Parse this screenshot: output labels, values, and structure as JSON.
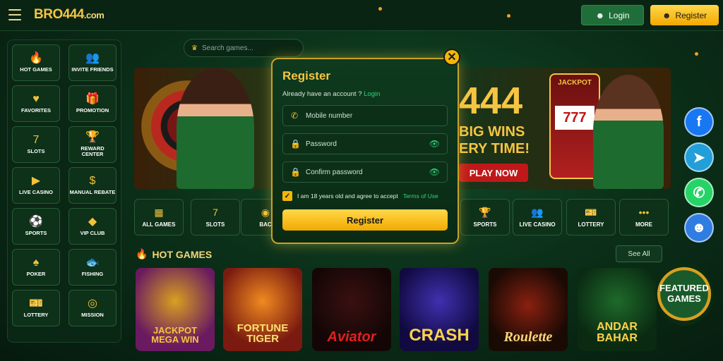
{
  "header": {
    "logo": "BRO444",
    "logo_suffix": ".com",
    "login_label": "Login",
    "register_label": "Register"
  },
  "search": {
    "placeholder": "Search games..."
  },
  "sidebar": {
    "items": [
      {
        "label": "HOT GAMES",
        "icon": "flame-icon"
      },
      {
        "label": "INVITE FRIENDS",
        "icon": "friends-icon"
      },
      {
        "label": "FAVORITES",
        "icon": "heart-icon"
      },
      {
        "label": "PROMOTION",
        "icon": "gift-icon"
      },
      {
        "label": "SLOTS",
        "icon": "slot-icon"
      },
      {
        "label": "REWARD CENTER",
        "icon": "trophy-icon"
      },
      {
        "label": "LIVE CASINO",
        "icon": "video-icon"
      },
      {
        "label": "MANUAL REBATE",
        "icon": "money-bag-icon"
      },
      {
        "label": "SPORTS",
        "icon": "soccer-ball-icon"
      },
      {
        "label": "VIP CLUB",
        "icon": "diamond-icon"
      },
      {
        "label": "POKER",
        "icon": "cards-icon"
      },
      {
        "label": "FISHING",
        "icon": "fish-icon"
      },
      {
        "label": "LOTTERY",
        "icon": "ticket-icon"
      },
      {
        "label": "MISSION",
        "icon": "target-icon"
      }
    ]
  },
  "banner": {
    "number": "444",
    "line1": "BIG WINS",
    "line2": "ERY TIME!",
    "cta": "PLAY NOW",
    "jackpot": "JACKPOT",
    "reels": "777"
  },
  "categories": [
    {
      "label": "ALL GAMES",
      "icon": "grid-icon"
    },
    {
      "label": "SLOTS",
      "icon": "slot-icon"
    },
    {
      "label": "BAC",
      "icon": "chip-icon"
    },
    {
      "label": "SPORTS",
      "icon": "trophy-icon"
    },
    {
      "label": "LIVE CASINO",
      "icon": "friends-icon"
    },
    {
      "label": "LOTTERY",
      "icon": "ticket-icon"
    },
    {
      "label": "MORE",
      "icon": "more-icon"
    }
  ],
  "hot_games": {
    "title": "HOT GAMES",
    "see_all": "See All",
    "games": [
      {
        "title": "JACKPOT MEGA WIN"
      },
      {
        "title": "FORTUNE TIGER"
      },
      {
        "title": "Aviator"
      },
      {
        "title": "CRASH"
      },
      {
        "title": "Roulette"
      },
      {
        "title": "ANDAR BAHAR"
      }
    ],
    "featured": "FEATURED GAMES"
  },
  "modal": {
    "title": "Register",
    "account_text": "Already have an account ?",
    "login_link": "Login",
    "mobile_placeholder": "Mobile number",
    "password_placeholder": "Password",
    "confirm_placeholder": "Confirm password",
    "agree_text": "I am 18 years old and agree to accept",
    "terms_link": "Terms of Use",
    "submit": "Register"
  },
  "colors": {
    "accent": "#f5c542",
    "link": "#2fd47a",
    "background": "#0b2a18"
  }
}
